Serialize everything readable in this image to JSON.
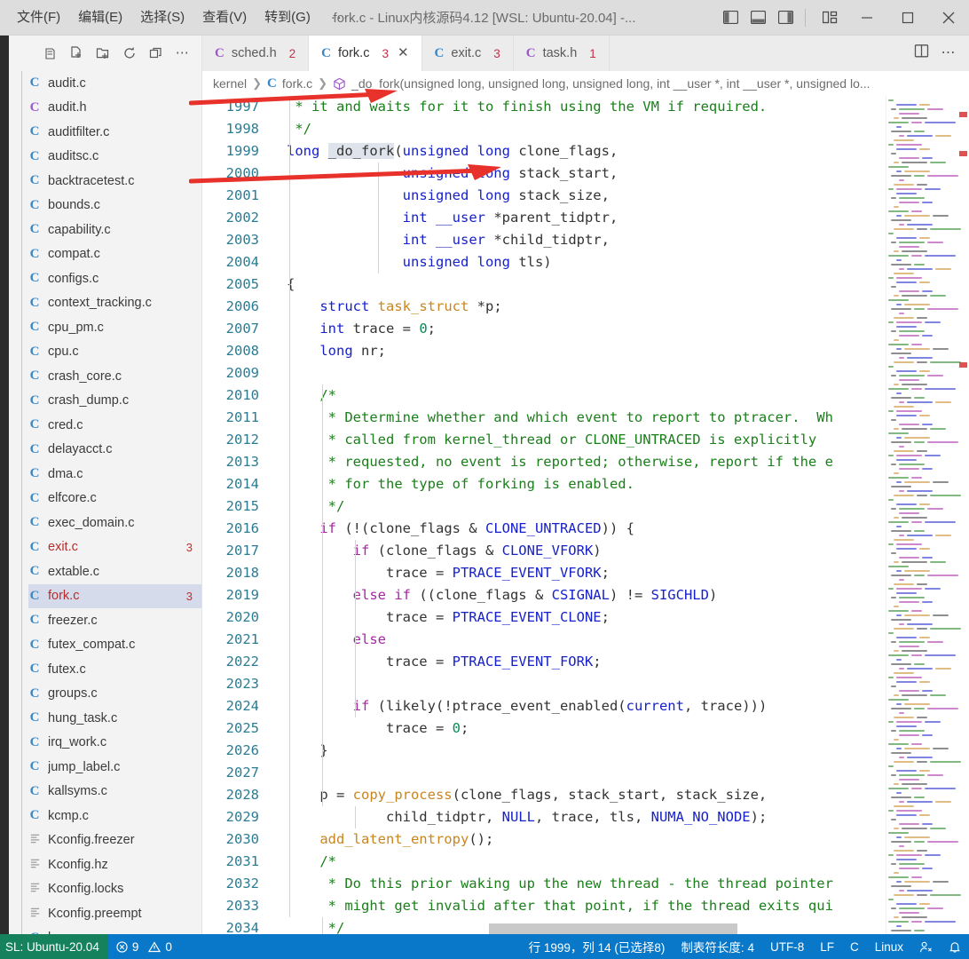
{
  "window": {
    "title": "fork.c - Linux内核源码4.12 [WSL: Ubuntu-20.04] -...",
    "menus": [
      "文件(F)",
      "编辑(E)",
      "选择(S)",
      "查看(V)",
      "转到(G)",
      "···"
    ],
    "layout_icons": [
      "toggle-primary-sidebar-icon",
      "toggle-panel-icon",
      "toggle-secondary-sidebar-icon",
      "customize-layout-icon"
    ],
    "controls": [
      "minimize",
      "maximize",
      "close"
    ]
  },
  "sidebar": {
    "toolbar": [
      "new-file-icon",
      "new-folder-icon",
      "refresh-icon",
      "collapse-all-icon",
      "more-actions-icon"
    ],
    "files": [
      {
        "name": "audit.c",
        "icon": "c",
        "badge": "",
        "selected": false
      },
      {
        "name": "audit.h",
        "icon": "h",
        "badge": "",
        "selected": false
      },
      {
        "name": "auditfilter.c",
        "icon": "c",
        "badge": "",
        "selected": false
      },
      {
        "name": "auditsc.c",
        "icon": "c",
        "badge": "",
        "selected": false
      },
      {
        "name": "backtracetest.c",
        "icon": "c",
        "badge": "",
        "selected": false
      },
      {
        "name": "bounds.c",
        "icon": "c",
        "badge": "",
        "selected": false
      },
      {
        "name": "capability.c",
        "icon": "c",
        "badge": "",
        "selected": false
      },
      {
        "name": "compat.c",
        "icon": "c",
        "badge": "",
        "selected": false
      },
      {
        "name": "configs.c",
        "icon": "c",
        "badge": "",
        "selected": false
      },
      {
        "name": "context_tracking.c",
        "icon": "c",
        "badge": "",
        "selected": false
      },
      {
        "name": "cpu_pm.c",
        "icon": "c",
        "badge": "",
        "selected": false
      },
      {
        "name": "cpu.c",
        "icon": "c",
        "badge": "",
        "selected": false
      },
      {
        "name": "crash_core.c",
        "icon": "c",
        "badge": "",
        "selected": false
      },
      {
        "name": "crash_dump.c",
        "icon": "c",
        "badge": "",
        "selected": false
      },
      {
        "name": "cred.c",
        "icon": "c",
        "badge": "",
        "selected": false
      },
      {
        "name": "delayacct.c",
        "icon": "c",
        "badge": "",
        "selected": false
      },
      {
        "name": "dma.c",
        "icon": "c",
        "badge": "",
        "selected": false
      },
      {
        "name": "elfcore.c",
        "icon": "c",
        "badge": "",
        "selected": false
      },
      {
        "name": "exec_domain.c",
        "icon": "c",
        "badge": "",
        "selected": false
      },
      {
        "name": "exit.c",
        "icon": "c",
        "badge": "3",
        "selected": false
      },
      {
        "name": "extable.c",
        "icon": "c",
        "badge": "",
        "selected": false
      },
      {
        "name": "fork.c",
        "icon": "c",
        "badge": "3",
        "selected": true
      },
      {
        "name": "freezer.c",
        "icon": "c",
        "badge": "",
        "selected": false
      },
      {
        "name": "futex_compat.c",
        "icon": "c",
        "badge": "",
        "selected": false
      },
      {
        "name": "futex.c",
        "icon": "c",
        "badge": "",
        "selected": false
      },
      {
        "name": "groups.c",
        "icon": "c",
        "badge": "",
        "selected": false
      },
      {
        "name": "hung_task.c",
        "icon": "c",
        "badge": "",
        "selected": false
      },
      {
        "name": "irq_work.c",
        "icon": "c",
        "badge": "",
        "selected": false
      },
      {
        "name": "jump_label.c",
        "icon": "c",
        "badge": "",
        "selected": false
      },
      {
        "name": "kallsyms.c",
        "icon": "c",
        "badge": "",
        "selected": false
      },
      {
        "name": "kcmp.c",
        "icon": "c",
        "badge": "",
        "selected": false
      },
      {
        "name": "Kconfig.freezer",
        "icon": "cfg",
        "badge": "",
        "selected": false
      },
      {
        "name": "Kconfig.hz",
        "icon": "cfg",
        "badge": "",
        "selected": false
      },
      {
        "name": "Kconfig.locks",
        "icon": "cfg",
        "badge": "",
        "selected": false
      },
      {
        "name": "Kconfig.preempt",
        "icon": "cfg",
        "badge": "",
        "selected": false
      },
      {
        "name": "kcov.c",
        "icon": "c",
        "badge": "",
        "selected": false
      }
    ]
  },
  "tabs": [
    {
      "label": "sched.h",
      "icon": "h",
      "count": "2",
      "active": false,
      "closable": false
    },
    {
      "label": "fork.c",
      "icon": "c",
      "count": "3",
      "active": true,
      "closable": true
    },
    {
      "label": "exit.c",
      "icon": "c",
      "count": "3",
      "active": false,
      "closable": false
    },
    {
      "label": "task.h",
      "icon": "h",
      "count": "1",
      "active": false,
      "closable": false
    }
  ],
  "editor_actions": [
    "split-editor-icon",
    "more-actions-icon"
  ],
  "breadcrumb": {
    "folder": "kernel",
    "file": "fork.c",
    "symbol": "_do_fork(unsigned long, unsigned long, unsigned long, int __user *, int __user *, unsigned lo..."
  },
  "code": {
    "first_line": 1997,
    "selected_symbol": "_do_fork",
    "lines": [
      {
        "n": 1997,
        "segments": [
          {
            "t": " * it and waits for it to finish using the VM if required.",
            "c": "tok-c"
          }
        ]
      },
      {
        "n": 1998,
        "segments": [
          {
            "t": " */",
            "c": "tok-c"
          }
        ]
      },
      {
        "n": 1999,
        "segments": [
          {
            "t": "long ",
            "c": "tok-t"
          },
          {
            "t": "_do_fork",
            "c": "tok-id sel-tok"
          },
          {
            "t": "(",
            "c": "tok-p"
          },
          {
            "t": "unsigned long",
            "c": "tok-t"
          },
          {
            "t": " clone_flags,",
            "c": "tok-id"
          }
        ]
      },
      {
        "n": 2000,
        "segments": [
          {
            "t": "              ",
            "c": "tok-p"
          },
          {
            "t": "unsigned long",
            "c": "tok-t"
          },
          {
            "t": " stack_start,",
            "c": "tok-id"
          }
        ]
      },
      {
        "n": 2001,
        "segments": [
          {
            "t": "              ",
            "c": "tok-p"
          },
          {
            "t": "unsigned long",
            "c": "tok-t"
          },
          {
            "t": " stack_size,",
            "c": "tok-id"
          }
        ]
      },
      {
        "n": 2002,
        "segments": [
          {
            "t": "              ",
            "c": "tok-p"
          },
          {
            "t": "int",
            "c": "tok-t"
          },
          {
            "t": " ",
            "c": "tok-p"
          },
          {
            "t": "__user",
            "c": "tok-t"
          },
          {
            "t": " *parent_tidptr,",
            "c": "tok-id"
          }
        ]
      },
      {
        "n": 2003,
        "segments": [
          {
            "t": "              ",
            "c": "tok-p"
          },
          {
            "t": "int",
            "c": "tok-t"
          },
          {
            "t": " ",
            "c": "tok-p"
          },
          {
            "t": "__user",
            "c": "tok-t"
          },
          {
            "t": " *child_tidptr,",
            "c": "tok-id"
          }
        ]
      },
      {
        "n": 2004,
        "segments": [
          {
            "t": "              ",
            "c": "tok-p"
          },
          {
            "t": "unsigned long",
            "c": "tok-t"
          },
          {
            "t": " tls)",
            "c": "tok-id"
          }
        ]
      },
      {
        "n": 2005,
        "segments": [
          {
            "t": "{",
            "c": "tok-p"
          }
        ]
      },
      {
        "n": 2006,
        "segments": [
          {
            "t": "    ",
            "c": "tok-p"
          },
          {
            "t": "struct",
            "c": "tok-t"
          },
          {
            "t": " ",
            "c": "tok-p"
          },
          {
            "t": "task_struct",
            "c": "tok-fn"
          },
          {
            "t": " *p;",
            "c": "tok-id"
          }
        ]
      },
      {
        "n": 2007,
        "segments": [
          {
            "t": "    ",
            "c": "tok-p"
          },
          {
            "t": "int",
            "c": "tok-t"
          },
          {
            "t": " trace = ",
            "c": "tok-id"
          },
          {
            "t": "0",
            "c": "tok-num"
          },
          {
            "t": ";",
            "c": "tok-p"
          }
        ]
      },
      {
        "n": 2008,
        "segments": [
          {
            "t": "    ",
            "c": "tok-p"
          },
          {
            "t": "long",
            "c": "tok-t"
          },
          {
            "t": " nr;",
            "c": "tok-id"
          }
        ]
      },
      {
        "n": 2009,
        "segments": []
      },
      {
        "n": 2010,
        "segments": [
          {
            "t": "    /*",
            "c": "tok-c"
          }
        ]
      },
      {
        "n": 2011,
        "segments": [
          {
            "t": "     * Determine whether and which event to report to ptracer.  Wh",
            "c": "tok-c"
          }
        ]
      },
      {
        "n": 2012,
        "segments": [
          {
            "t": "     * called from kernel_thread or CLONE_UNTRACED is explicitly",
            "c": "tok-c"
          }
        ]
      },
      {
        "n": 2013,
        "segments": [
          {
            "t": "     * requested, no event is reported; otherwise, report if the e",
            "c": "tok-c"
          }
        ]
      },
      {
        "n": 2014,
        "segments": [
          {
            "t": "     * for the type of forking is enabled.",
            "c": "tok-c"
          }
        ]
      },
      {
        "n": 2015,
        "segments": [
          {
            "t": "     */",
            "c": "tok-c"
          }
        ]
      },
      {
        "n": 2016,
        "segments": [
          {
            "t": "    ",
            "c": "tok-p"
          },
          {
            "t": "if",
            "c": "tok-k"
          },
          {
            "t": " (!(clone_flags & ",
            "c": "tok-id"
          },
          {
            "t": "CLONE_UNTRACED",
            "c": "tok-const"
          },
          {
            "t": ")) {",
            "c": "tok-id"
          }
        ]
      },
      {
        "n": 2017,
        "segments": [
          {
            "t": "        ",
            "c": "tok-p"
          },
          {
            "t": "if",
            "c": "tok-k"
          },
          {
            "t": " (clone_flags & ",
            "c": "tok-id"
          },
          {
            "t": "CLONE_VFORK",
            "c": "tok-const"
          },
          {
            "t": ")",
            "c": "tok-id"
          }
        ]
      },
      {
        "n": 2018,
        "segments": [
          {
            "t": "            trace = ",
            "c": "tok-id"
          },
          {
            "t": "PTRACE_EVENT_VFORK",
            "c": "tok-const"
          },
          {
            "t": ";",
            "c": "tok-id"
          }
        ]
      },
      {
        "n": 2019,
        "segments": [
          {
            "t": "        ",
            "c": "tok-p"
          },
          {
            "t": "else if",
            "c": "tok-k"
          },
          {
            "t": " ((clone_flags & ",
            "c": "tok-id"
          },
          {
            "t": "CSIGNAL",
            "c": "tok-const"
          },
          {
            "t": ") != ",
            "c": "tok-id"
          },
          {
            "t": "SIGCHLD",
            "c": "tok-const"
          },
          {
            "t": ")",
            "c": "tok-id"
          }
        ]
      },
      {
        "n": 2020,
        "segments": [
          {
            "t": "            trace = ",
            "c": "tok-id"
          },
          {
            "t": "PTRACE_EVENT_CLONE",
            "c": "tok-const"
          },
          {
            "t": ";",
            "c": "tok-id"
          }
        ]
      },
      {
        "n": 2021,
        "segments": [
          {
            "t": "        ",
            "c": "tok-p"
          },
          {
            "t": "else",
            "c": "tok-k"
          }
        ]
      },
      {
        "n": 2022,
        "segments": [
          {
            "t": "            trace = ",
            "c": "tok-id"
          },
          {
            "t": "PTRACE_EVENT_FORK",
            "c": "tok-const"
          },
          {
            "t": ";",
            "c": "tok-id"
          }
        ]
      },
      {
        "n": 2023,
        "segments": []
      },
      {
        "n": 2024,
        "segments": [
          {
            "t": "        ",
            "c": "tok-p"
          },
          {
            "t": "if",
            "c": "tok-k"
          },
          {
            "t": " (likely(!ptrace_event_enabled(",
            "c": "tok-id"
          },
          {
            "t": "current",
            "c": "tok-const"
          },
          {
            "t": ", trace)))",
            "c": "tok-id"
          }
        ]
      },
      {
        "n": 2025,
        "segments": [
          {
            "t": "            trace = ",
            "c": "tok-id"
          },
          {
            "t": "0",
            "c": "tok-num"
          },
          {
            "t": ";",
            "c": "tok-id"
          }
        ]
      },
      {
        "n": 2026,
        "segments": [
          {
            "t": "    }",
            "c": "tok-p"
          }
        ]
      },
      {
        "n": 2027,
        "segments": []
      },
      {
        "n": 2028,
        "segments": [
          {
            "t": "    p = ",
            "c": "tok-id"
          },
          {
            "t": "copy_process",
            "c": "tok-fn"
          },
          {
            "t": "(clone_flags, stack_start, stack_size,",
            "c": "tok-id"
          }
        ]
      },
      {
        "n": 2029,
        "segments": [
          {
            "t": "            child_tidptr, ",
            "c": "tok-id"
          },
          {
            "t": "NULL",
            "c": "tok-const"
          },
          {
            "t": ", trace, tls, ",
            "c": "tok-id"
          },
          {
            "t": "NUMA_NO_NODE",
            "c": "tok-const"
          },
          {
            "t": ");",
            "c": "tok-id"
          }
        ]
      },
      {
        "n": 2030,
        "segments": [
          {
            "t": "    ",
            "c": "tok-p"
          },
          {
            "t": "add_latent_entropy",
            "c": "tok-fn"
          },
          {
            "t": "();",
            "c": "tok-id"
          }
        ]
      },
      {
        "n": 2031,
        "segments": [
          {
            "t": "    /*",
            "c": "tok-c"
          }
        ]
      },
      {
        "n": 2032,
        "segments": [
          {
            "t": "     * Do this prior waking up the new thread - the thread pointer",
            "c": "tok-c"
          }
        ]
      },
      {
        "n": 2033,
        "segments": [
          {
            "t": "     * might get invalid after that point, if the thread exits qui",
            "c": "tok-c"
          }
        ]
      },
      {
        "n": 2034,
        "segments": [
          {
            "t": "     */",
            "c": "tok-c"
          }
        ]
      }
    ]
  },
  "statusbar": {
    "remote": "SL: Ubuntu-20.04",
    "errors": "9",
    "warnings": "0",
    "position": "行 1999，列 14 (已选择8)",
    "tab_size": "制表符长度: 4",
    "encoding": "UTF-8",
    "eol": "LF",
    "language": "C",
    "platform": "Linux",
    "icons": [
      "feedback-icon",
      "bell-icon"
    ]
  },
  "annotations": {
    "arrow_color": "#e8312a",
    "arrows": [
      {
        "name": "arrow-to-breadcrumb-symbol"
      },
      {
        "name": "arrow-to-function-signature"
      }
    ]
  }
}
